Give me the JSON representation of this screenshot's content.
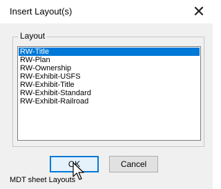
{
  "window": {
    "title": "Insert Layout(s)",
    "close_glyph": "✕"
  },
  "layout_group": {
    "label": "Layout",
    "items": [
      {
        "label": "RW-Title",
        "selected": true
      },
      {
        "label": "RW-Plan",
        "selected": false
      },
      {
        "label": "RW-Ownership",
        "selected": false
      },
      {
        "label": "RW-Exhibit-USFS",
        "selected": false
      },
      {
        "label": "RW-Exhibit-Title",
        "selected": false
      },
      {
        "label": "RW-Exhibit-Standard",
        "selected": false
      },
      {
        "label": "RW-Exhibit-Railroad",
        "selected": false
      }
    ]
  },
  "buttons": {
    "ok_label": "OK",
    "cancel_label": "Cancel"
  },
  "status": {
    "text": "MDT sheet Layouts"
  },
  "colors": {
    "selection": "#0078d7",
    "dialog_bg": "#f0f0f0"
  },
  "cursor": {
    "icon": "arrow-pointer-icon"
  }
}
